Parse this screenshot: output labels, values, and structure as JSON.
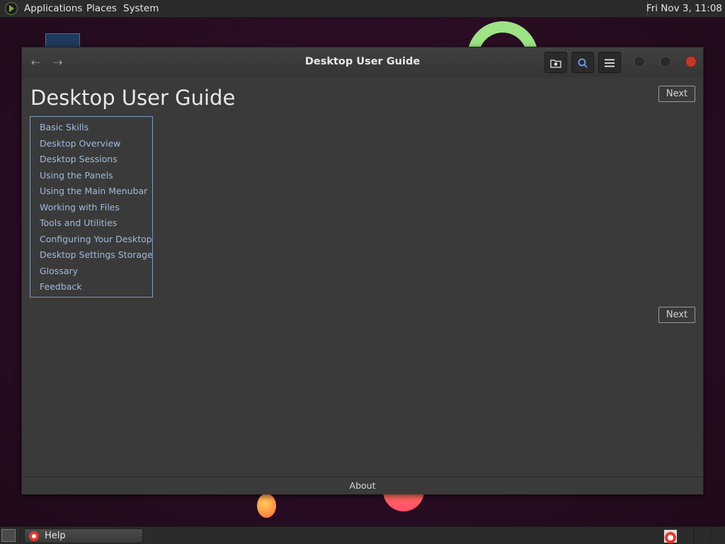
{
  "top_panel": {
    "menus": [
      "Applications",
      "Places",
      "System"
    ],
    "clock": "Fri Nov  3, 11:08"
  },
  "window": {
    "title": "Desktop User Guide",
    "page_title": "Desktop User Guide",
    "next_label": "Next",
    "toc": [
      "Basic Skills",
      "Desktop Overview",
      "Desktop Sessions",
      "Using the Panels",
      "Using the Main Menubar",
      "Working with Files",
      "Tools and Utilities",
      "Configuring Your Desktop",
      "Desktop Settings Storage",
      "Glossary",
      "Feedback"
    ],
    "footer_link": "About"
  },
  "taskbar": {
    "task_label": "Help"
  },
  "icons": {
    "back": "arrow-left-icon",
    "forward": "arrow-right-icon",
    "bookmarks": "bookmark-folder-icon",
    "search": "search-icon",
    "menu": "hamburger-menu-icon"
  },
  "colors": {
    "link": "#9fbbe0",
    "window_bg": "#3a3a3a",
    "panel_bg": "#2b2b2b",
    "close_button": "#c0392b"
  }
}
